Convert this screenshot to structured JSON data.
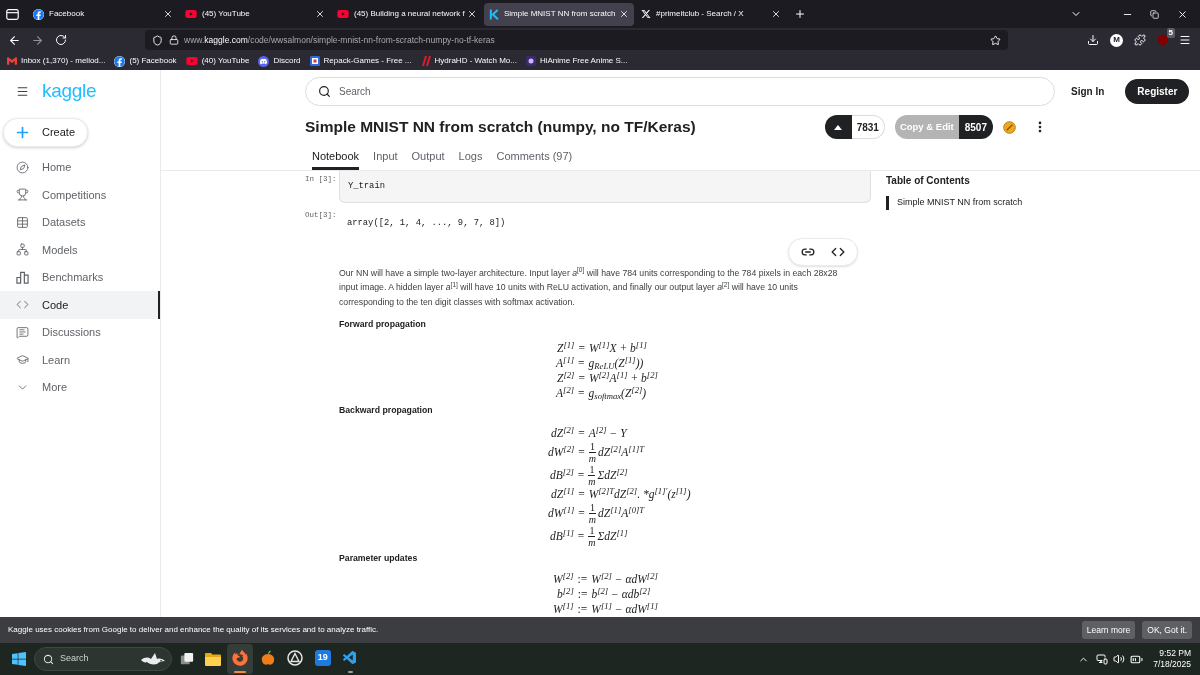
{
  "browser": {
    "tabs": [
      {
        "title": "Facebook",
        "selected": false
      },
      {
        "title": "(45) YouTube",
        "selected": false
      },
      {
        "title": "(45) Building a neural network f",
        "selected": false
      },
      {
        "title": "Simple MNIST NN from scratch",
        "selected": true
      },
      {
        "title": "#primeitclub - Search / X",
        "selected": false
      }
    ],
    "url": {
      "prefix": "www.",
      "host": "kaggle.com",
      "path": "/code/wwsalmon/simple-mnist-nn-from-scratch-numpy-no-tf-keras"
    },
    "profile_letter": "M",
    "extension_badge": "5",
    "bookmarks": [
      "Inbox (1,370) - meliod...",
      "(5) Facebook",
      "(40) YouTube",
      "Discord",
      "Repack-Games - Free ...",
      "HydraHD - Watch Mo...",
      "HiAnime Free Anime S..."
    ]
  },
  "kaggle": {
    "logo": "kaggle",
    "create": "Create",
    "nav": [
      {
        "label": "Home",
        "selected": false
      },
      {
        "label": "Competitions",
        "selected": false
      },
      {
        "label": "Datasets",
        "selected": false
      },
      {
        "label": "Models",
        "selected": false
      },
      {
        "label": "Benchmarks",
        "selected": false
      },
      {
        "label": "Code",
        "selected": true
      },
      {
        "label": "Discussions",
        "selected": false
      },
      {
        "label": "Learn",
        "selected": false
      },
      {
        "label": "More",
        "selected": false
      }
    ],
    "search": {
      "placeholder": "Search"
    },
    "sign_in": "Sign In",
    "register": "Register",
    "title": "Simple MNIST NN from scratch (numpy, no TF/Keras)",
    "votes": "7831",
    "copy_edit": "Copy & Edit",
    "copies": "8507",
    "tabs": [
      {
        "label": "Notebook",
        "selected": true
      },
      {
        "label": "Input",
        "selected": false
      },
      {
        "label": "Output",
        "selected": false
      },
      {
        "label": "Logs",
        "selected": false
      },
      {
        "label": "Comments (97)",
        "selected": false
      }
    ],
    "cells": [
      {
        "kind": "input",
        "prompt": "In [3]:",
        "text": "Y_train"
      },
      {
        "kind": "output",
        "prompt": "Out[3]:",
        "text": "array([2, 1, 4, ..., 9, 7, 8])"
      }
    ],
    "paragraph": "Our NN will have a simple two-layer architecture. Input layer *a*$^{[0]}$ will have 784 units corresponding to the 784 pixels in each 28x28 input image. A hidden layer *a*$^{[1]}$ will have 10 units with ReLU activation, and finally our output layer *a*$^{[2]}$ will have 10 units corresponding to the ten digit classes with softmax activation.",
    "sections": [
      {
        "heading": "Forward propagation",
        "equations": [
          {
            "lhs": "Z$^{[1]}$",
            "op": "=",
            "rhs": "W$^{[1]}$X + b$^{[1]}$"
          },
          {
            "lhs": "A$^{[1]}$",
            "op": "=",
            "rhs": "g$_{ReLU}$(Z$^{[1]}$))"
          },
          {
            "lhs": "Z$^{[2]}$",
            "op": "=",
            "rhs": "W$^{[2]}$A$^{[1]}$ + b$^{[2]}$"
          },
          {
            "lhs": "A$^{[2]}$",
            "op": "=",
            "rhs": "g$_{softmax}$(Z$^{[2]}$)"
          }
        ]
      },
      {
        "heading": "Backward propagation",
        "equations": [
          {
            "lhs": "dZ$^{[2]}$",
            "op": "=",
            "rhs": "A$^{[2]}$ − Y"
          },
          {
            "lhs": "dW$^{[2]}$",
            "op": "=",
            "frac": {
              "num": "1",
              "den": "m"
            },
            "rhs": "dZ$^{[2]}$A$^{[1]T}$"
          },
          {
            "lhs": "dB$^{[2]}$",
            "op": "=",
            "frac": {
              "num": "1",
              "den": "m"
            },
            "rhs": "ΣdZ$^{[2]}$"
          },
          {
            "lhs": "dZ$^{[1]}$",
            "op": "=",
            "rhs": "W$^{[2]T}$dZ$^{[2]}$. *g$^{[1]′}$(z$^{[1]}$)"
          },
          {
            "lhs": "dW$^{[1]}$",
            "op": "=",
            "frac": {
              "num": "1",
              "den": "m"
            },
            "rhs": "dZ$^{[1]}$A$^{[0]T}$"
          },
          {
            "lhs": "dB$^{[1]}$",
            "op": "=",
            "frac": {
              "num": "1",
              "den": "m"
            },
            "rhs": "ΣdZ$^{[1]}$"
          }
        ]
      },
      {
        "heading": "Parameter updates",
        "equations": [
          {
            "lhs": "W$^{[2]}$",
            "op": ":=",
            "rhs": "W$^{[2]}$ − αdW$^{[2]}$"
          },
          {
            "lhs": "b$^{[2]}$",
            "op": ":=",
            "rhs": "b$^{[2]}$ − αdb$^{[2]}$"
          },
          {
            "lhs": "W$^{[1]}$",
            "op": ":=",
            "rhs": "W$^{[1]}$ − αdW$^{[1]}$"
          }
        ]
      }
    ],
    "toc": {
      "title": "Table of Contents",
      "items": [
        {
          "label": "Simple MNIST NN from scratch",
          "selected": true
        }
      ]
    }
  },
  "cookie_bar": {
    "text": "Kaggle uses cookies from Google to deliver and enhance the quality of its services and to analyze traffic.",
    "buttons": [
      "Learn more",
      "OK, Got it."
    ]
  },
  "taskbar": {
    "search": {
      "placeholder": "Search"
    },
    "apps": [
      {
        "running": false,
        "selected": false
      },
      {
        "running": true,
        "selected": true
      },
      {
        "running": false,
        "selected": false
      },
      {
        "running": false,
        "selected": false
      },
      {
        "running": false,
        "selected": false,
        "text": "19"
      },
      {
        "running": true,
        "selected": false
      }
    ],
    "time": "9:52 PM",
    "date": "7/18/2025"
  }
}
